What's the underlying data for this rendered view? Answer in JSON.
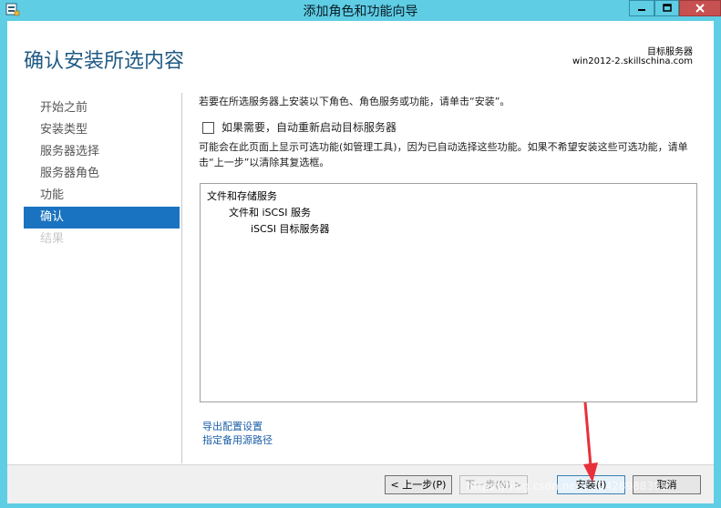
{
  "window": {
    "title": "添加角色和功能向导",
    "controls": [
      "minimize",
      "maximize",
      "close"
    ]
  },
  "header": {
    "page_title": "确认安装所选内容",
    "target_label": "目标服务器",
    "target_value": "win2012-2.skillschina.com"
  },
  "nav": {
    "items": [
      {
        "label": "开始之前",
        "state": "normal"
      },
      {
        "label": "安装类型",
        "state": "normal"
      },
      {
        "label": "服务器选择",
        "state": "normal"
      },
      {
        "label": "服务器角色",
        "state": "normal"
      },
      {
        "label": "功能",
        "state": "normal"
      },
      {
        "label": "确认",
        "state": "active"
      },
      {
        "label": "结果",
        "state": "disabled"
      }
    ]
  },
  "main": {
    "intro": "若要在所选服务器上安装以下角色、角色服务或功能，请单击“安装”。",
    "restart_checkbox": {
      "label": "如果需要，自动重新启动目标服务器",
      "checked": false
    },
    "note": "可能会在此页面上显示可选功能(如管理工具)，因为已自动选择这些功能。如果不希望安装这些可选功能，请单击“上一步”以清除其复选框。",
    "tree": [
      {
        "label": "文件和存储服务",
        "level": 0
      },
      {
        "label": "文件和 iSCSI 服务",
        "level": 1
      },
      {
        "label": "iSCSI 目标服务器",
        "level": 2
      }
    ],
    "links": {
      "export": "导出配置设置",
      "source": "指定备用源路径"
    }
  },
  "footer": {
    "prev": "< 上一步(P)",
    "next": "下一步(N) >",
    "install": "安装(I)",
    "cancel": "取消"
  },
  "watermark": "https://blog.csdn.net/.../2428988391",
  "colors": {
    "titlebar": "#5fcde4",
    "accent": "#1a73c0",
    "heading": "#1f5a84",
    "link": "#1e60a8",
    "arrow": "#e8303a"
  }
}
